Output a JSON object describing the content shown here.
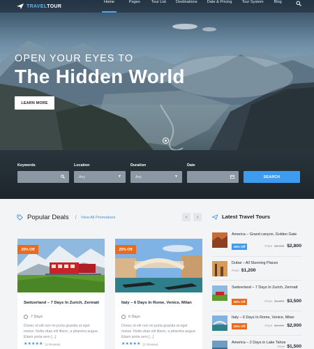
{
  "nav": {
    "logo": {
      "part1": "TRAVEL",
      "part2": "TOUR"
    },
    "items": [
      "Home",
      "Pages",
      "Tour List",
      "Destinations",
      "Date & Pricing",
      "Tour System",
      "Blog"
    ],
    "active": "Home",
    "search_icon": "search-icon"
  },
  "hero": {
    "subtitle": "OPEN YOUR EYES TO",
    "title": "The Hidden World",
    "button": "LEARN MORE"
  },
  "search": {
    "keywords_label": "Keywords",
    "location_label": "Location",
    "location_value": "Any",
    "duration_label": "Duration",
    "duration_value": "Any",
    "date_label": "Date",
    "button": "SEARCH"
  },
  "popular": {
    "title": "Popular Deals",
    "link": "View All Promotions",
    "prev": "‹",
    "next": "›",
    "cards": [
      {
        "badge": "20% Off",
        "title": "Switzerland – 7 Days In Zurich, Zermatt",
        "duration": "7 Days",
        "desc": "Donec id elit non mi porta gravida at eget metus. Nulla vitae elit libero, a pharetra augue. Etiam porta sem [...]",
        "stars": "★★★★★",
        "reviews": "(1 Review)"
      },
      {
        "badge": "25% Off",
        "title": "Italy – 6 Days In Rome, Venice, Milan",
        "duration": "6 Days",
        "desc": "Donec id elit non mi porta gravida at eget metus. Nulla vitae elit libero, a pharetra augue. Etiam porta sem [...]",
        "stars": "★★★★★",
        "reviews": "(1 Review)"
      }
    ]
  },
  "latest": {
    "title": "Latest Travel Tours",
    "tours": [
      {
        "title": "America – Grand canyon, Golden Gate",
        "badge": "15% Off",
        "badge_color": "#3d9cf0",
        "from": "From",
        "old": "$2,900",
        "price": "$2,800"
      },
      {
        "title": "Dubai – All Stunning Places",
        "badge": "",
        "badge_color": "",
        "from": "From",
        "old": "",
        "price": "$1,200"
      },
      {
        "title": "Switzerland – 7 Days In Zurich, Zermatt",
        "badge": "20% Off",
        "badge_color": "#ec6a1c",
        "from": "From",
        "old": "$4,300",
        "price": "$3,500"
      },
      {
        "title": "Italy – 6 Days In Rome, Venice, Milan",
        "badge": "25% Off",
        "badge_color": "#ec6a1c",
        "from": "From",
        "old": "$4,700",
        "price": "$2,000"
      },
      {
        "title": "America – 2 Days in Lake Tahoe",
        "badge": "",
        "badge_color": "",
        "from": "From",
        "old": "",
        "price": "$1,500"
      }
    ]
  },
  "colors": {
    "accent": "#3d9cf0",
    "badge": "#ec6a1c",
    "rating": "#3d8fdd"
  }
}
